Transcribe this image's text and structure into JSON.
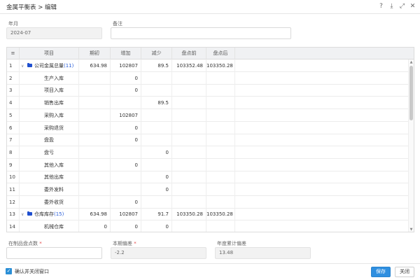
{
  "window": {
    "title": "金属平衡表 > 编辑",
    "icons": [
      "help-icon",
      "download-icon",
      "maximize-icon",
      "close-icon"
    ]
  },
  "form": {
    "period_label": "年月",
    "period_value": "2024-07",
    "remark_label": "备注",
    "remark_value": ""
  },
  "grid": {
    "columns": [
      "",
      "项目",
      "期初",
      "增加",
      "减少",
      "盘点前",
      "盘点后"
    ],
    "rows": [
      {
        "idx": "1",
        "name": "公司金属总量",
        "count": "(11)",
        "group": true,
        "qc": "634.98",
        "zj": "102807",
        "js": "89.5",
        "pdq": "103352.48",
        "pdh": "103350.28"
      },
      {
        "idx": "2",
        "name": "生产入库",
        "count": "",
        "group": false,
        "qc": "",
        "zj": "0",
        "js": "",
        "pdq": "",
        "pdh": ""
      },
      {
        "idx": "3",
        "name": "项目入库",
        "count": "",
        "group": false,
        "qc": "",
        "zj": "0",
        "js": "",
        "pdq": "",
        "pdh": ""
      },
      {
        "idx": "4",
        "name": "销售出库",
        "count": "",
        "group": false,
        "qc": "",
        "zj": "",
        "js": "89.5",
        "pdq": "",
        "pdh": ""
      },
      {
        "idx": "5",
        "name": "采购入库",
        "count": "",
        "group": false,
        "qc": "",
        "zj": "102807",
        "js": "",
        "pdq": "",
        "pdh": ""
      },
      {
        "idx": "6",
        "name": "采购退货",
        "count": "",
        "group": false,
        "qc": "",
        "zj": "0",
        "js": "",
        "pdq": "",
        "pdh": ""
      },
      {
        "idx": "7",
        "name": "盘盈",
        "count": "",
        "group": false,
        "qc": "",
        "zj": "0",
        "js": "",
        "pdq": "",
        "pdh": ""
      },
      {
        "idx": "8",
        "name": "盘亏",
        "count": "",
        "group": false,
        "qc": "",
        "zj": "",
        "js": "0",
        "pdq": "",
        "pdh": ""
      },
      {
        "idx": "9",
        "name": "其他入库",
        "count": "",
        "group": false,
        "qc": "",
        "zj": "0",
        "js": "",
        "pdq": "",
        "pdh": ""
      },
      {
        "idx": "10",
        "name": "其他出库",
        "count": "",
        "group": false,
        "qc": "",
        "zj": "",
        "js": "0",
        "pdq": "",
        "pdh": ""
      },
      {
        "idx": "11",
        "name": "委外发料",
        "count": "",
        "group": false,
        "qc": "",
        "zj": "",
        "js": "0",
        "pdq": "",
        "pdh": ""
      },
      {
        "idx": "12",
        "name": "委外收货",
        "count": "",
        "group": false,
        "qc": "",
        "zj": "0",
        "js": "",
        "pdq": "",
        "pdh": ""
      },
      {
        "idx": "13",
        "name": "仓库库存",
        "count": "(15)",
        "group": true,
        "qc": "634.98",
        "zj": "102807",
        "js": "91.7",
        "pdq": "103350.28",
        "pdh": "103350.28"
      },
      {
        "idx": "14",
        "name": "机械仓库",
        "count": "",
        "group": false,
        "qc": "0",
        "zj": "0",
        "js": "0",
        "pdq": "",
        "pdh": ""
      }
    ]
  },
  "footer_fields": {
    "wip_label": "在制品盘点数",
    "wip_required": "*",
    "wip_value": "",
    "deviation_label": "本期偏差",
    "deviation_required": "*",
    "deviation_value": "-2.2",
    "annual_label": "年度累计偏差",
    "annual_value": "13.48"
  },
  "bottom": {
    "confirm_close_label": "确认并关闭窗口",
    "confirm_close_checked": true,
    "save_label": "保存",
    "close_label": "关闭"
  },
  "colors": {
    "primary": "#2f8fe0",
    "folder": "#1f4fcf",
    "count_text": "#2b5fd9",
    "required": "#e24a4a"
  }
}
